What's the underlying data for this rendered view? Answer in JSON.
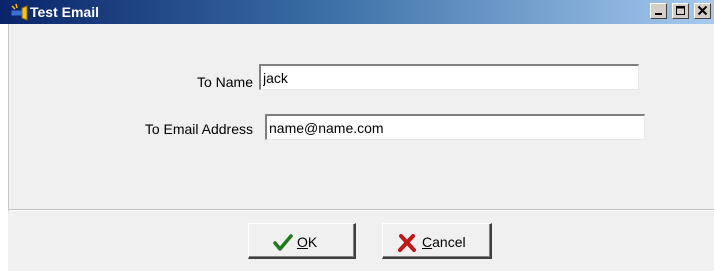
{
  "window": {
    "title": "Test Email",
    "icon": "flashlight-app-icon"
  },
  "title_buttons": {
    "minimize_icon": "minimize-icon",
    "maximize_icon": "maximize-icon",
    "close_icon": "close-icon"
  },
  "form": {
    "to_name": {
      "label": "To Name",
      "value": "jack"
    },
    "to_email": {
      "label": "To Email Address",
      "value": "name@name.com"
    }
  },
  "buttons": {
    "ok": {
      "mnemonic": "O",
      "rest": "K",
      "icon": "checkmark-icon",
      "icon_color": "#1f7a1f"
    },
    "cancel": {
      "mnemonic": "C",
      "rest": "ancel",
      "icon": "x-mark-icon",
      "icon_color": "#c01818"
    }
  },
  "colors": {
    "titlebar_start": "#0a246a",
    "titlebar_end": "#a6caf0",
    "dialog_bg": "#f0f0f0"
  }
}
